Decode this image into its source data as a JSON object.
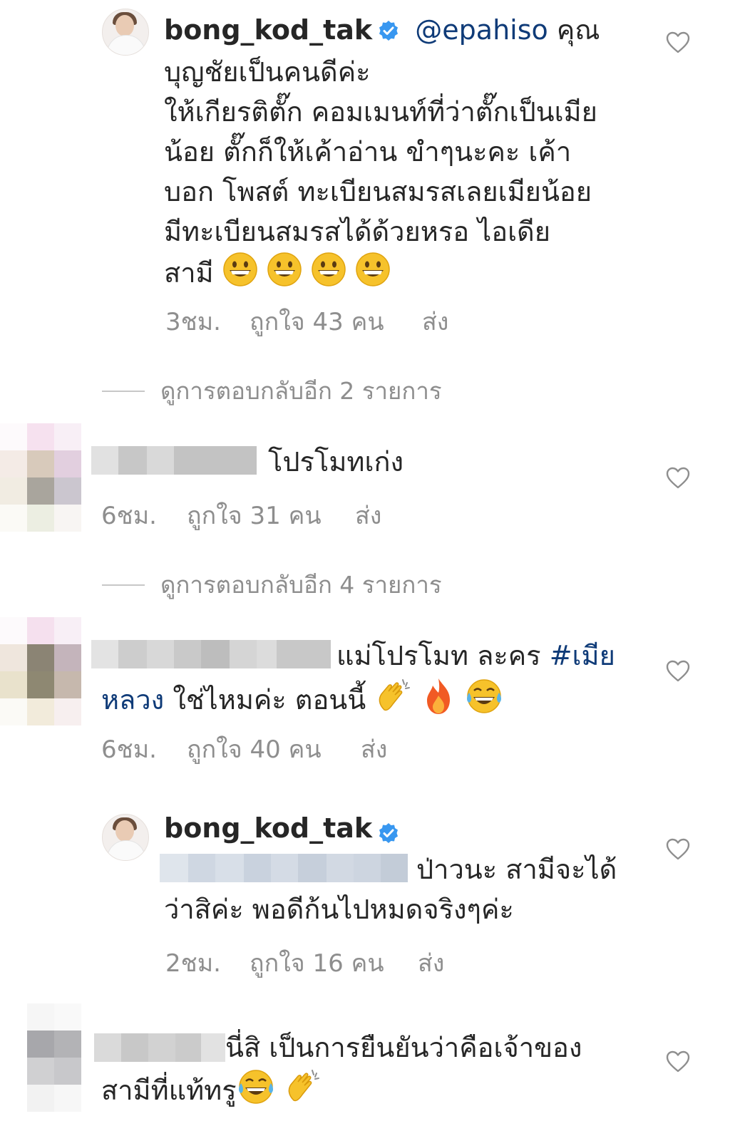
{
  "comments": [
    {
      "username": "bong_kod_tak",
      "verified": true,
      "mention": "@epahiso",
      "lines": [
        "คุณ",
        "บุญชัยเป็นคนดีค่ะ",
        "ให้เกียรติตั๊ก คอมเมนท์ที่ว่าตั๊กเป็นเมีย",
        "น้อย ตั๊กก็ให้เค้าอ่าน ขำๆนะคะ เค้า",
        "บอก โพสต์ ทะเบียนสมรสเลยเมียน้อย",
        "มีทะเบียนสมรสได้ด้วยหรอ  ไอเดีย",
        "สามี"
      ],
      "emojis": [
        "grinning-face",
        "grinning-face",
        "grinning-face",
        "grinning-face"
      ],
      "time": "3ชม.",
      "likes": "ถูกใจ 43 คน",
      "reply": "ส่ง"
    },
    {
      "view_replies": "ดูการตอบกลับอีก 2 รายการ"
    },
    {
      "text": "โปรโมทเก่ง",
      "time": "6ชม.",
      "likes": "ถูกใจ 31 คน",
      "reply": "ส่ง"
    },
    {
      "view_replies": "ดูการตอบกลับอีก 4 รายการ"
    },
    {
      "text_before": "แม่โปรโมท ละคร ",
      "hashtag_1": "#เมีย",
      "hashtag_2": "หลวง",
      "text_after": " ใช่ไหมค่ะ ตอนนี้",
      "emojis": [
        "clapping-hands",
        "fire",
        "tears-of-joy"
      ],
      "time": "6ชม.",
      "likes": "ถูกใจ 40 คน",
      "reply": "ส่ง"
    },
    {
      "username": "bong_kod_tak",
      "verified": true,
      "line_1": "ป่าวนะ สามีจะได้",
      "line_2": "ว่าสิค่ะ พอดีก้นไปหมดจริงๆค่ะ",
      "time": "2ชม.",
      "likes": "ถูกใจ 16 คน",
      "reply": "ส่ง"
    },
    {
      "line_1": "นี่สิ เป็นการยืนยันว่าคือเจ้าของ",
      "line_2": "สามีที่แท้ทรู",
      "emojis": [
        "tears-of-joy",
        "clapping-hands"
      ]
    }
  ],
  "colors": {
    "text": "#262626",
    "meta": "#8e8e8e",
    "link": "#0f3b78",
    "verified": "#3897f0"
  }
}
